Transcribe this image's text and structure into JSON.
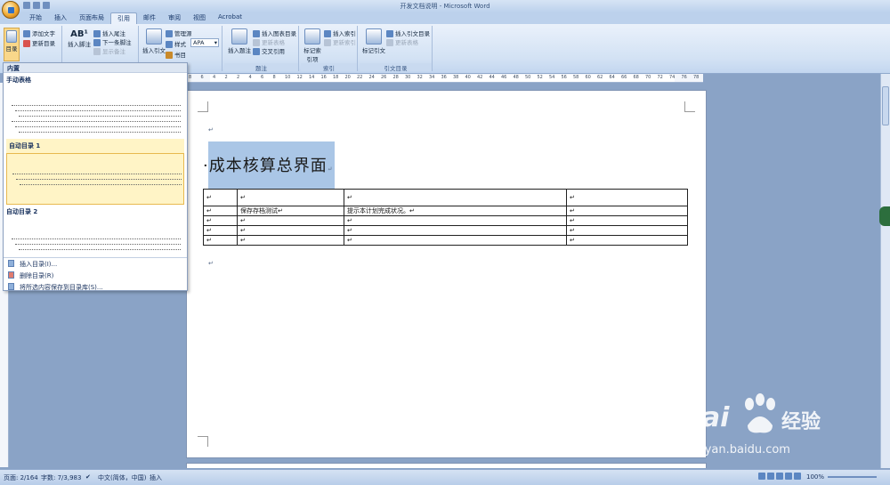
{
  "window": {
    "title": "开发文档说明 - Microsoft Word"
  },
  "tabs": [
    {
      "label": "开始"
    },
    {
      "label": "插入"
    },
    {
      "label": "页面布局"
    },
    {
      "label": "引用"
    },
    {
      "label": "邮件"
    },
    {
      "label": "审阅"
    },
    {
      "label": "视图"
    },
    {
      "label": "Acrobat"
    }
  ],
  "ribbon": {
    "toc": {
      "big": "目录",
      "add_text": "添加文字",
      "update": "更新目录"
    },
    "footnote": {
      "big": "插入脚注",
      "insert_endnote": "插入尾注",
      "next_footnote": "下一条脚注",
      "show_notes": "显示备注",
      "label": "脚注"
    },
    "citation": {
      "big": "插入引文",
      "manage": "管理源",
      "style_label": "样式",
      "style_value": "APA",
      "bibliography": "书目",
      "label": "引文与书目"
    },
    "caption": {
      "big": "插入题注",
      "insert_table_figures": "插入图表目录",
      "update_table": "更新表格",
      "cross_ref": "交叉引用",
      "label": "题注"
    },
    "index": {
      "big": "标记索引项",
      "insert_index": "插入索引",
      "update_index": "更新索引",
      "label": "索引"
    },
    "authorities": {
      "big": "标记引文",
      "insert_table": "插入引文目录",
      "update_table": "更新表格",
      "label": "引文目录"
    }
  },
  "toc_dropdown": {
    "header": "内置",
    "manual_title": "手动表格",
    "auto1_title": "自动目录 1",
    "auto2_title": "自动目录 2",
    "menu": [
      {
        "label": "插入目录(I)..."
      },
      {
        "label": "删除目录(R)"
      },
      {
        "label": "将所选内容保存到目录库(S)..."
      }
    ]
  },
  "document": {
    "heading": "成本核算总界面",
    "paragraph_mark": "↵",
    "table": {
      "rows": [
        [
          "↵",
          "↵",
          "↵",
          "↵"
        ],
        [
          "↵",
          "保存存档测试↵",
          "提示本计划完成状况。↵",
          "↵"
        ],
        [
          "↵",
          "↵",
          "↵",
          "↵"
        ],
        [
          "↵",
          "↵",
          "↵",
          "↵"
        ],
        [
          "↵",
          "↵",
          "↵",
          "↵"
        ]
      ]
    }
  },
  "ruler_ticks": [
    "8",
    "6",
    "4",
    "2",
    "2",
    "4",
    "6",
    "8",
    "10",
    "12",
    "14",
    "16",
    "18",
    "20",
    "22",
    "24",
    "26",
    "28",
    "30",
    "32",
    "34",
    "36",
    "38",
    "40",
    "42",
    "44",
    "46",
    "48",
    "50",
    "52",
    "54",
    "56",
    "58",
    "60",
    "62",
    "64",
    "66",
    "68",
    "70",
    "72",
    "74",
    "76",
    "78"
  ],
  "status": {
    "page": "页面: 2/164",
    "words": "字数: 7/3,983",
    "language": "中文(简体，中国)",
    "mode": "插入",
    "zoom": "100%"
  },
  "watermark": {
    "brand": "Bai",
    "brand_cn": "经验",
    "url": "jingyan.baidu.com"
  },
  "colors": {
    "ribbon": "#d3e2f4",
    "selection": "#aac6e6",
    "highlight": "#fff4c6"
  }
}
